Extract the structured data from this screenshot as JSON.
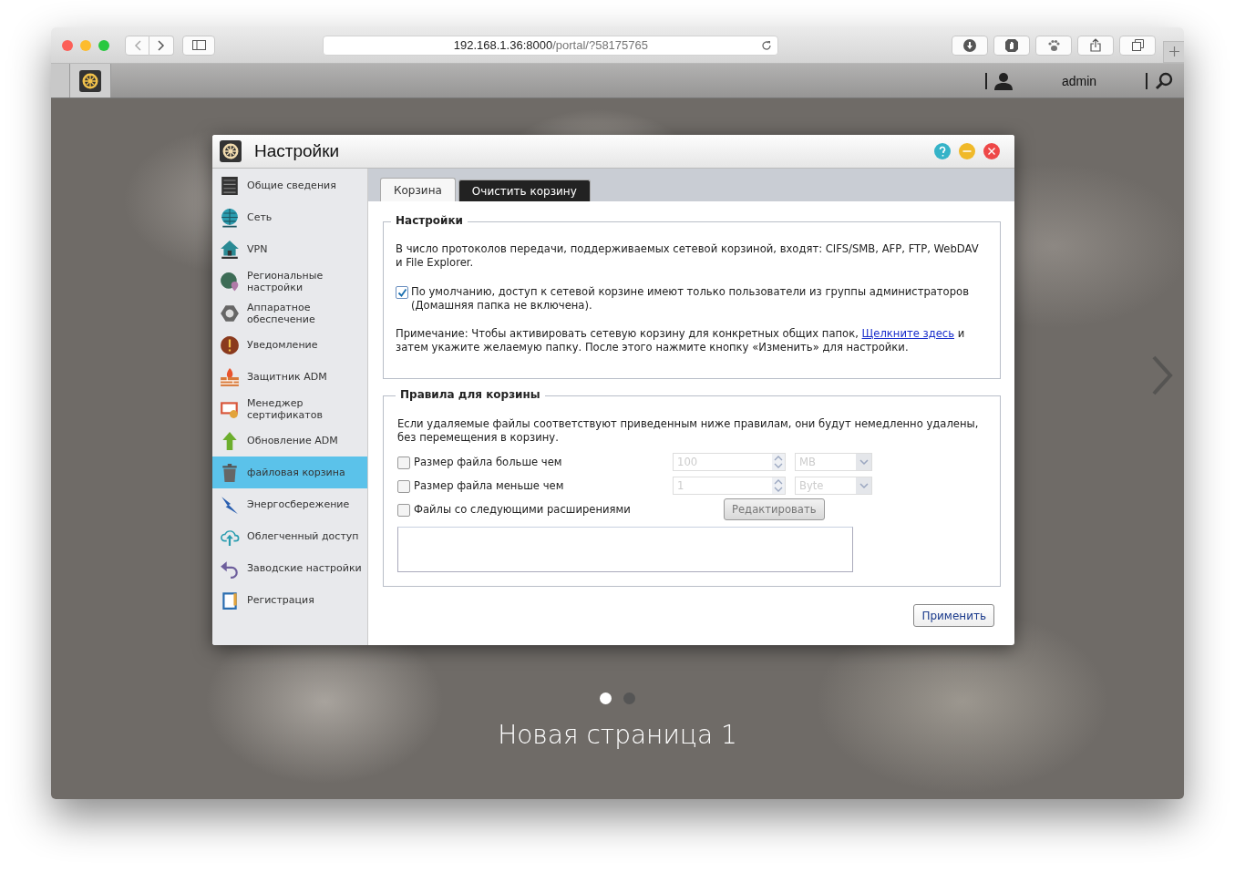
{
  "browser": {
    "address_host": "192.168.1.36:8000",
    "address_path": "/portal/?58175765"
  },
  "topbar": {
    "user": "admin"
  },
  "dialog": {
    "title": "Настройки",
    "sidebar": [
      {
        "label": "Общие сведения",
        "selected": false
      },
      {
        "label": "Сеть",
        "selected": false
      },
      {
        "label": "VPN",
        "selected": false
      },
      {
        "label": "Региональные настройки",
        "selected": false
      },
      {
        "label": "Аппаратное обеспечение",
        "selected": false
      },
      {
        "label": "Уведомление",
        "selected": false
      },
      {
        "label": "Защитник ADM",
        "selected": false
      },
      {
        "label": "Менеджер сертификатов",
        "selected": false
      },
      {
        "label": "Обновление ADM",
        "selected": false
      },
      {
        "label": "файловая корзина",
        "selected": true
      },
      {
        "label": "Энергосбережение",
        "selected": false
      },
      {
        "label": "Облегченный доступ",
        "selected": false
      },
      {
        "label": "Заводские настройки",
        "selected": false
      },
      {
        "label": "Регистрация",
        "selected": false
      }
    ],
    "tabs": [
      {
        "label": "Корзина",
        "selected": true
      },
      {
        "label": "Очистить корзину",
        "selected": false
      }
    ],
    "settings_section": {
      "legend": "Настройки",
      "text": "В число протоколов передачи, поддерживаемых сетевой корзиной, входят: CIFS/SMB, AFP, FTP, WebDAV и File Explorer.",
      "default_access": {
        "checked": true,
        "label": "По умолчанию, доступ к сетевой корзине имеют только пользователи из группы администраторов (Домашняя папка не включена)."
      },
      "note_before": "Примечание: Чтобы активировать сетевую корзину для конкретных общих папок, ",
      "note_link": "Щелкните здесь",
      "note_after": " и затем укажите желаемую папку. После этого нажмите кнопку «Изменить» для настройки."
    },
    "rules_section": {
      "legend": "Правила для корзины",
      "text": "Если удаляемые файлы соответствуют приведенным ниже правилам, они будут немедленно удалены, без перемещения в корзину.",
      "rules": [
        {
          "kind": "size",
          "checked": false,
          "label": "Размер файла больше чем",
          "value": "100",
          "unit": "MB",
          "disabled": true
        },
        {
          "kind": "size",
          "checked": false,
          "label": "Размер файла меньше чем",
          "value": "1",
          "unit": "Byte",
          "disabled": true
        },
        {
          "kind": "extensions",
          "checked": false,
          "label": "Файлы со следующими расширениями",
          "button": "Редактировать",
          "disabled": true
        }
      ]
    },
    "apply_button": "Применить"
  },
  "desktop": {
    "pages": [
      {
        "selected": true
      },
      {
        "selected": false
      }
    ],
    "page_title": "Новая страница 1"
  }
}
